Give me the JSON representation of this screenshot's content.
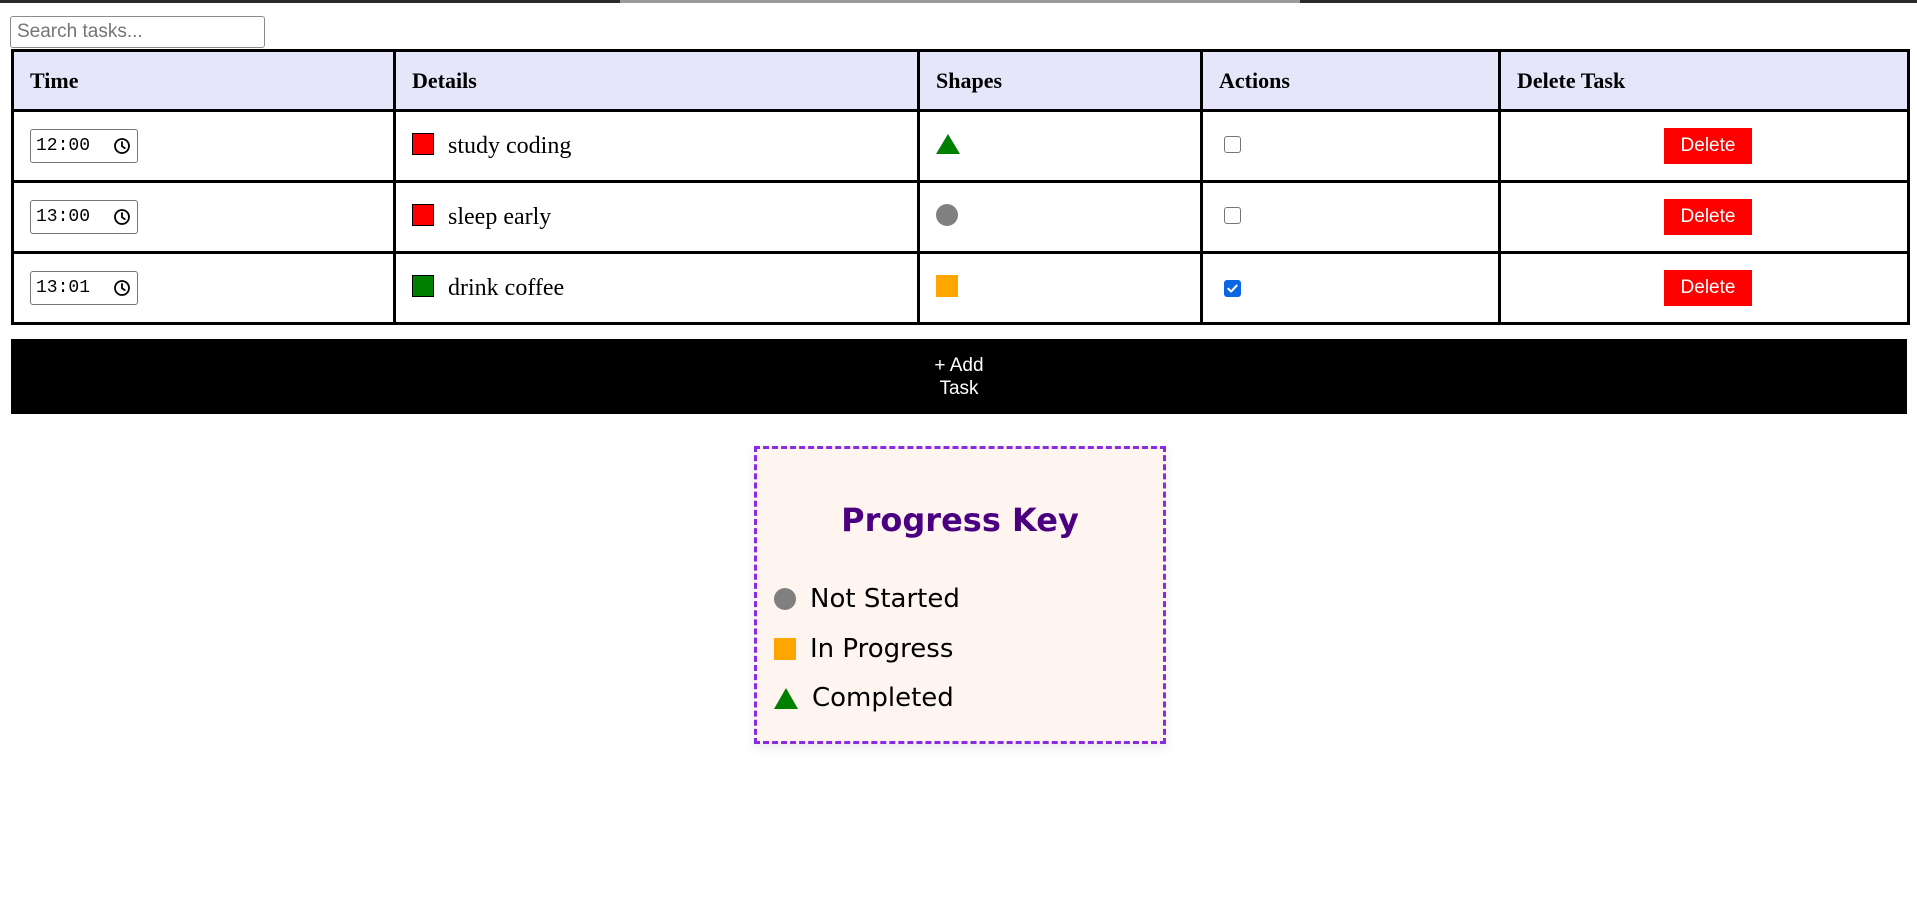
{
  "search": {
    "placeholder": "Search tasks...",
    "value": ""
  },
  "table": {
    "headers": [
      "Time",
      "Details",
      "Shapes",
      "Actions",
      "Delete Task"
    ],
    "rows": [
      {
        "time": "12:00",
        "detail": "study coding",
        "swatch_color": "#ff0000",
        "shape": "triangle",
        "shape_color": "#008000",
        "checked": false,
        "delete_label": "Delete"
      },
      {
        "time": "13:00",
        "detail": "sleep early",
        "swatch_color": "#ff0000",
        "shape": "circle",
        "shape_color": "#808080",
        "checked": false,
        "delete_label": "Delete"
      },
      {
        "time": "13:01",
        "detail": "drink coffee",
        "swatch_color": "#008000",
        "shape": "square",
        "shape_color": "#ffa500",
        "checked": true,
        "delete_label": "Delete"
      }
    ]
  },
  "add_button": {
    "line1": "+ Add",
    "line2": "Task"
  },
  "progress_key": {
    "title": "Progress Key",
    "items": [
      {
        "shape": "circle",
        "color": "#808080",
        "label": "Not Started"
      },
      {
        "shape": "square",
        "color": "#ffa500",
        "label": "In Progress"
      },
      {
        "shape": "triangle",
        "color": "#008000",
        "label": "Completed"
      }
    ]
  },
  "colors": {
    "header_bg": "#e6e6fa",
    "delete": "#ff0000",
    "add_bg": "#000000",
    "key_border": "#8a2be2",
    "key_bg": "#fff5f0",
    "key_title": "#4b0082",
    "checkbox_on": "#0b66e4"
  }
}
